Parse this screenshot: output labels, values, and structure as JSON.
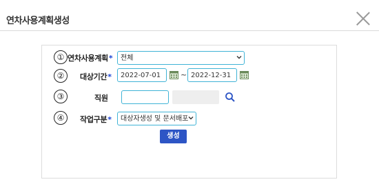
{
  "dialog": {
    "title": "연차사용계획생성"
  },
  "form": {
    "rows": [
      {
        "number": "①",
        "label": "연차사용계획",
        "required_mark": "*"
      },
      {
        "number": "②",
        "label": "대상기간",
        "required_mark": "*"
      },
      {
        "number": "③",
        "label": "직원",
        "required_mark": ""
      },
      {
        "number": "④",
        "label": "작업구분",
        "required_mark": "*"
      }
    ],
    "plan_select": {
      "value": "전체"
    },
    "period": {
      "start": "2022-07-01",
      "separator": "~",
      "end": "2022-12-31"
    },
    "employee": {
      "value": "",
      "name": ""
    },
    "work_type_select": {
      "value": "대상자생성 및 문서배포"
    },
    "submit_label": "생성"
  },
  "colors": {
    "accent_border": "#3fb3d6",
    "button": "#2d55c5",
    "required": "#1b44d6"
  },
  "icons": {
    "close": "close-icon",
    "calendar": "calendar-icon",
    "search": "search-icon",
    "dropdown": "chevron-down-icon"
  }
}
